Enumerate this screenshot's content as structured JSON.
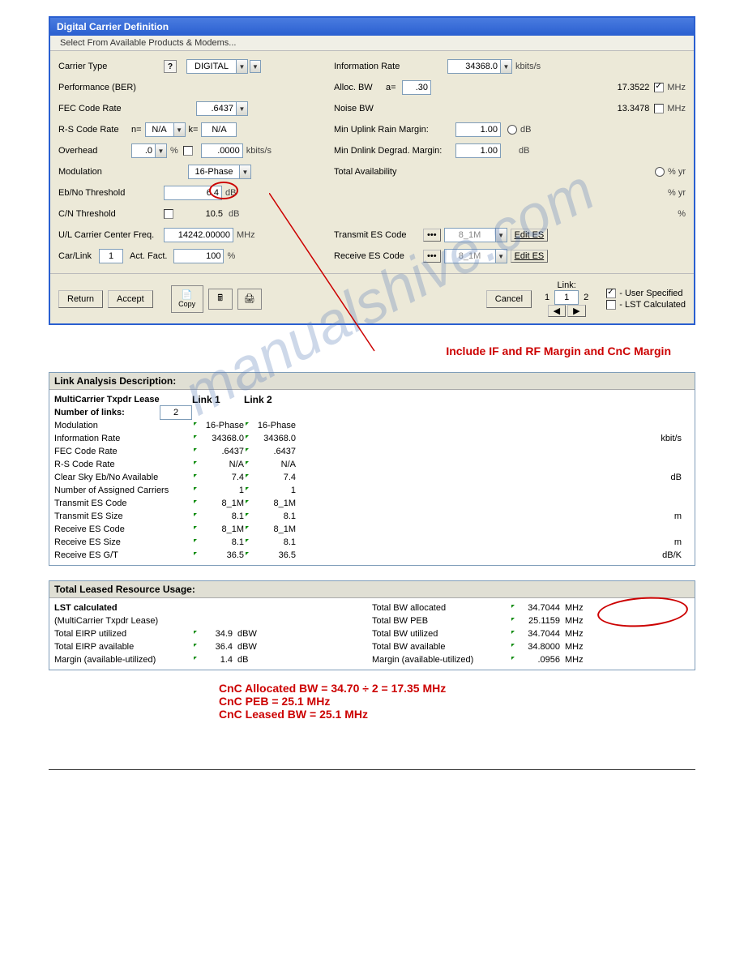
{
  "title": "Digital Carrier Definition",
  "toolbar_select": "Select From Available Products & Modems...",
  "left": {
    "carrier_type": "Carrier Type",
    "carrier_type_val": "DIGITAL",
    "perf": "Performance (BER)",
    "fec": "FEC Code Rate",
    "fec_val": ".6437",
    "rs": "R-S Code Rate",
    "rs_n": "n=",
    "rs_nval": "N/A",
    "rs_k": "k=",
    "rs_kval": "N/A",
    "overhead": "Overhead",
    "ov_val": ".0",
    "ov_pct": "%",
    "ov_out": ".0000",
    "ov_unit": "kbits/s",
    "mod": "Modulation",
    "mod_val": "16-Phase",
    "ebno": "Eb/No Threshold",
    "ebno_val": "6.4",
    "ebno_unit": "dB",
    "cn": "C/N Threshold",
    "cn_val": "10.5",
    "cn_unit": "dB",
    "ulcf": "U/L Carrier Center Freq.",
    "ulcf_val": "14242.00000",
    "ulcf_unit": "MHz",
    "carlink": "Car/Link",
    "carlink_val": "1",
    "actfact": "Act. Fact.",
    "actfact_val": "100",
    "actfact_unit": "%"
  },
  "right": {
    "ir": "Information Rate",
    "ir_val": "34368.0",
    "ir_unit": "kbits/s",
    "alloc": "Alloc. BW",
    "alloc_a": "a=",
    "alloc_aval": ".30",
    "alloc_out": "17.3522",
    "alloc_unit": "MHz",
    "nbw": "Noise BW",
    "nbw_val": "13.3478",
    "nbw_unit": "MHz",
    "minup": "Min Uplink Rain Margin:",
    "minup_val": "1.00",
    "minup_unit": "dB",
    "mindn": "Min Dnlink Degrad. Margin:",
    "mindn_val": "1.00",
    "mindn_unit": "dB",
    "ta": "Total Availability",
    "ta_unit": "% yr",
    "ta_unit2": "% yr",
    "ta_unit3": "%",
    "tx": "Transmit ES Code",
    "tx_val": "8_1M",
    "edit": "Edit ES",
    "rx": "Receive ES Code",
    "rx_val": "8_1M",
    "link": "Link:",
    "link_val": "1",
    "link_1": "1",
    "link_2": "2",
    "us": "- User Specified",
    "lc": "- LST Calculated"
  },
  "btns": {
    "return": "Return",
    "accept": "Accept",
    "copy": "Copy",
    "cancel": "Cancel"
  },
  "annot1": "Include IF and RF Margin and CnC Margin",
  "la": {
    "head": "Link Analysis Description:",
    "mctl": "MultiCarrier Txpdr Lease",
    "l1": "Link 1",
    "l2": "Link 2",
    "nlinks": "Number of links:",
    "nlinks_val": "2",
    "rows": [
      {
        "l": "Modulation",
        "a": "16-Phase",
        "b": "16-Phase",
        "u": ""
      },
      {
        "l": "Information Rate",
        "a": "34368.0",
        "b": "34368.0",
        "u": "kbit/s"
      },
      {
        "l": "FEC Code Rate",
        "a": ".6437",
        "b": ".6437",
        "u": ""
      },
      {
        "l": "R-S Code Rate",
        "a": "N/A",
        "b": "N/A",
        "u": ""
      },
      {
        "l": "Clear Sky Eb/No Available",
        "a": "7.4",
        "b": "7.4",
        "u": "dB"
      },
      {
        "l": "Number of Assigned Carriers",
        "a": "1",
        "b": "1",
        "u": ""
      },
      {
        "l": "Transmit ES Code",
        "a": "8_1M",
        "b": "8_1M",
        "u": ""
      },
      {
        "l": "Transmit ES Size",
        "a": "8.1",
        "b": "8.1",
        "u": "m"
      },
      {
        "l": "Receive ES Code",
        "a": "8_1M",
        "b": "8_1M",
        "u": ""
      },
      {
        "l": "Receive ES Size",
        "a": "8.1",
        "b": "8.1",
        "u": "m"
      },
      {
        "l": "Receive ES G/T",
        "a": "36.5",
        "b": "36.5",
        "u": "dB/K"
      }
    ]
  },
  "tl": {
    "head": "Total Leased Resource Usage:",
    "lst": "LST calculated",
    "mctl": "(MultiCarrier Txpdr Lease)",
    "left": [
      {
        "l": "Total EIRP utilized",
        "v": "34.9",
        "u": "dBW"
      },
      {
        "l": "Total EIRP available",
        "v": "36.4",
        "u": "dBW"
      },
      {
        "l": "Margin (available-utilized)",
        "v": "1.4",
        "u": "dB"
      }
    ],
    "right": [
      {
        "l": "Total BW allocated",
        "v": "34.7044",
        "u": "MHz"
      },
      {
        "l": "Total BW PEB",
        "v": "25.1159",
        "u": "MHz"
      },
      {
        "l": "Total BW utilized",
        "v": "34.7044",
        "u": "MHz"
      },
      {
        "l": "Total BW available",
        "v": "34.8000",
        "u": "MHz"
      },
      {
        "l": "Margin (available-utilized)",
        "v": ".0956",
        "u": "MHz"
      }
    ]
  },
  "annot2": {
    "a": "CnC Allocated BW = 34.70 ÷ 2 = 17.35 MHz",
    "b": "CnC PEB = 25.1 MHz",
    "c": "CnC Leased BW = 25.1 MHz"
  }
}
